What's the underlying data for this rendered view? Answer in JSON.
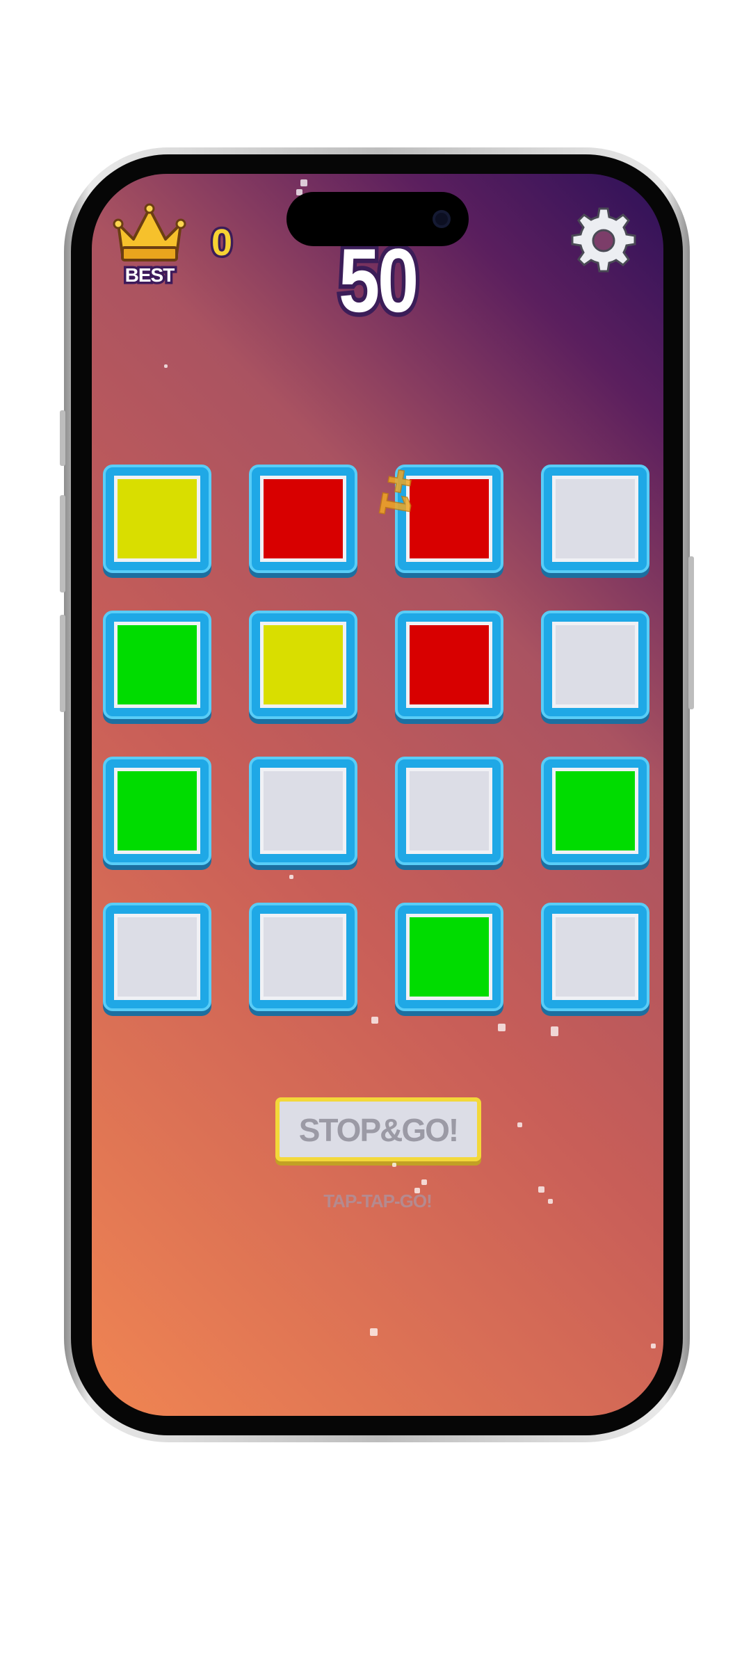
{
  "hud": {
    "best_label": "BEST",
    "best_value": "0",
    "score": "50",
    "icons": {
      "best": "crown-icon",
      "settings": "gear-icon"
    }
  },
  "board": {
    "rows": 4,
    "columns": 4,
    "tiles": [
      [
        "yellow",
        "red",
        "red",
        "empty"
      ],
      [
        "green",
        "yellow",
        "red",
        "empty"
      ],
      [
        "green",
        "empty",
        "empty",
        "green"
      ],
      [
        "empty",
        "empty",
        "green",
        "empty"
      ]
    ],
    "colors": {
      "yellow": "#d9de00",
      "red": "#d80000",
      "green": "#00dc00",
      "empty": "#dcdde6"
    },
    "popup": "+1"
  },
  "controls": {
    "stop_button_label": "STOP&GO!",
    "hint": "TAP-TAP-GO!"
  }
}
